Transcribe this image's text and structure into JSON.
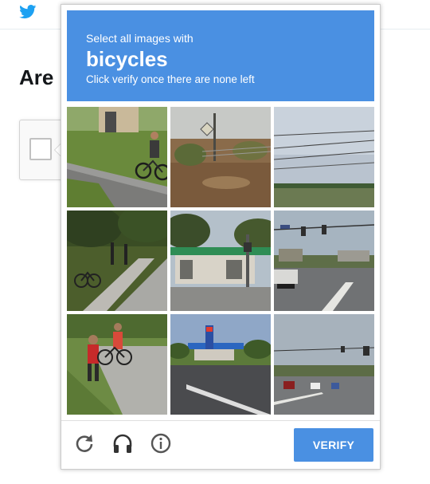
{
  "background_page": {
    "heading": "Are"
  },
  "challenge": {
    "instruction": "Select all images with",
    "target": "bicycles",
    "hint": "Click verify once there are none left",
    "tiles": [
      {
        "name": "tile-1",
        "selected": false
      },
      {
        "name": "tile-2",
        "selected": false
      },
      {
        "name": "tile-3",
        "selected": false
      },
      {
        "name": "tile-4",
        "selected": false
      },
      {
        "name": "tile-5",
        "selected": false
      },
      {
        "name": "tile-6",
        "selected": false
      },
      {
        "name": "tile-7",
        "selected": false
      },
      {
        "name": "tile-8",
        "selected": false
      },
      {
        "name": "tile-9",
        "selected": false
      }
    ],
    "footer_icons": [
      "reload-icon",
      "audio-icon",
      "info-icon"
    ],
    "verify_label": "VERIFY"
  },
  "colors": {
    "accent": "#4a90e2",
    "brand_twitter": "#1da1f2"
  }
}
